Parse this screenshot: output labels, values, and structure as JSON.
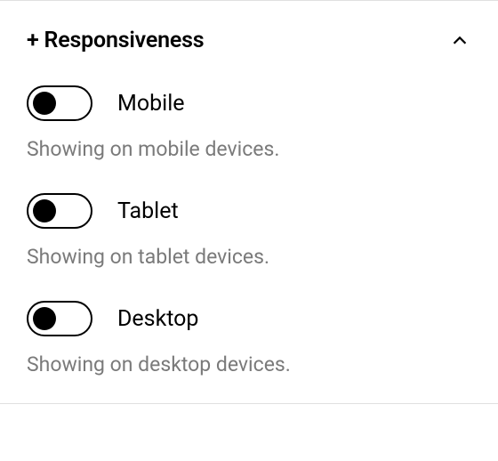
{
  "section": {
    "title": "+ Responsiveness",
    "expanded": true
  },
  "items": [
    {
      "label": "Mobile",
      "description": "Showing on mobile devices.",
      "enabled": true
    },
    {
      "label": "Tablet",
      "description": "Showing on tablet devices.",
      "enabled": true
    },
    {
      "label": "Desktop",
      "description": "Showing on desktop devices.",
      "enabled": true
    }
  ]
}
